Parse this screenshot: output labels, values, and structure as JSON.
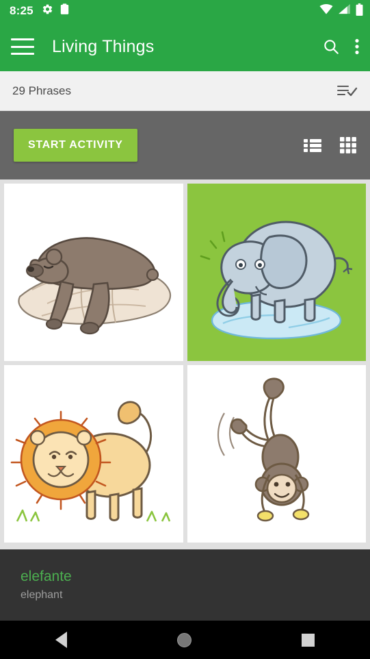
{
  "status_bar": {
    "time": "8:25",
    "left_icons": [
      "gear-icon",
      "clipboard-icon"
    ],
    "right_icons": [
      "wifi-icon",
      "cell-signal-icon",
      "battery-icon"
    ],
    "background": "#2aa745"
  },
  "app_bar": {
    "title": "Living Things",
    "menu_icon": "hamburger-menu-icon",
    "actions": [
      "search-icon",
      "overflow-menu-icon"
    ],
    "background": "#2aa745"
  },
  "sub_header": {
    "count_label": "29 Phrases",
    "select_all_icon": "select-all-checklist-icon"
  },
  "toolbar": {
    "start_activity_label": "START ACTIVITY",
    "start_activity_color": "#8bc53f",
    "list_view_icon": "list-view-icon",
    "grid_view_icon": "grid-view-icon",
    "background": "#666666"
  },
  "grid": {
    "cards": [
      {
        "name": "bear",
        "selected": false,
        "background": "#ffffff"
      },
      {
        "name": "elephant",
        "selected": true,
        "background": "#8bc53f"
      },
      {
        "name": "lion",
        "selected": false,
        "background": "#ffffff"
      },
      {
        "name": "monkey",
        "selected": false,
        "background": "#ffffff"
      }
    ]
  },
  "caption": {
    "primary": "elefante",
    "secondary": "elephant",
    "primary_color": "#4caf50",
    "secondary_color": "#9e9e9e",
    "background": "#333333"
  },
  "nav_bar": {
    "back_icon": "back-triangle-icon",
    "home_icon": "home-circle-icon",
    "recent_icon": "recent-square-icon"
  }
}
